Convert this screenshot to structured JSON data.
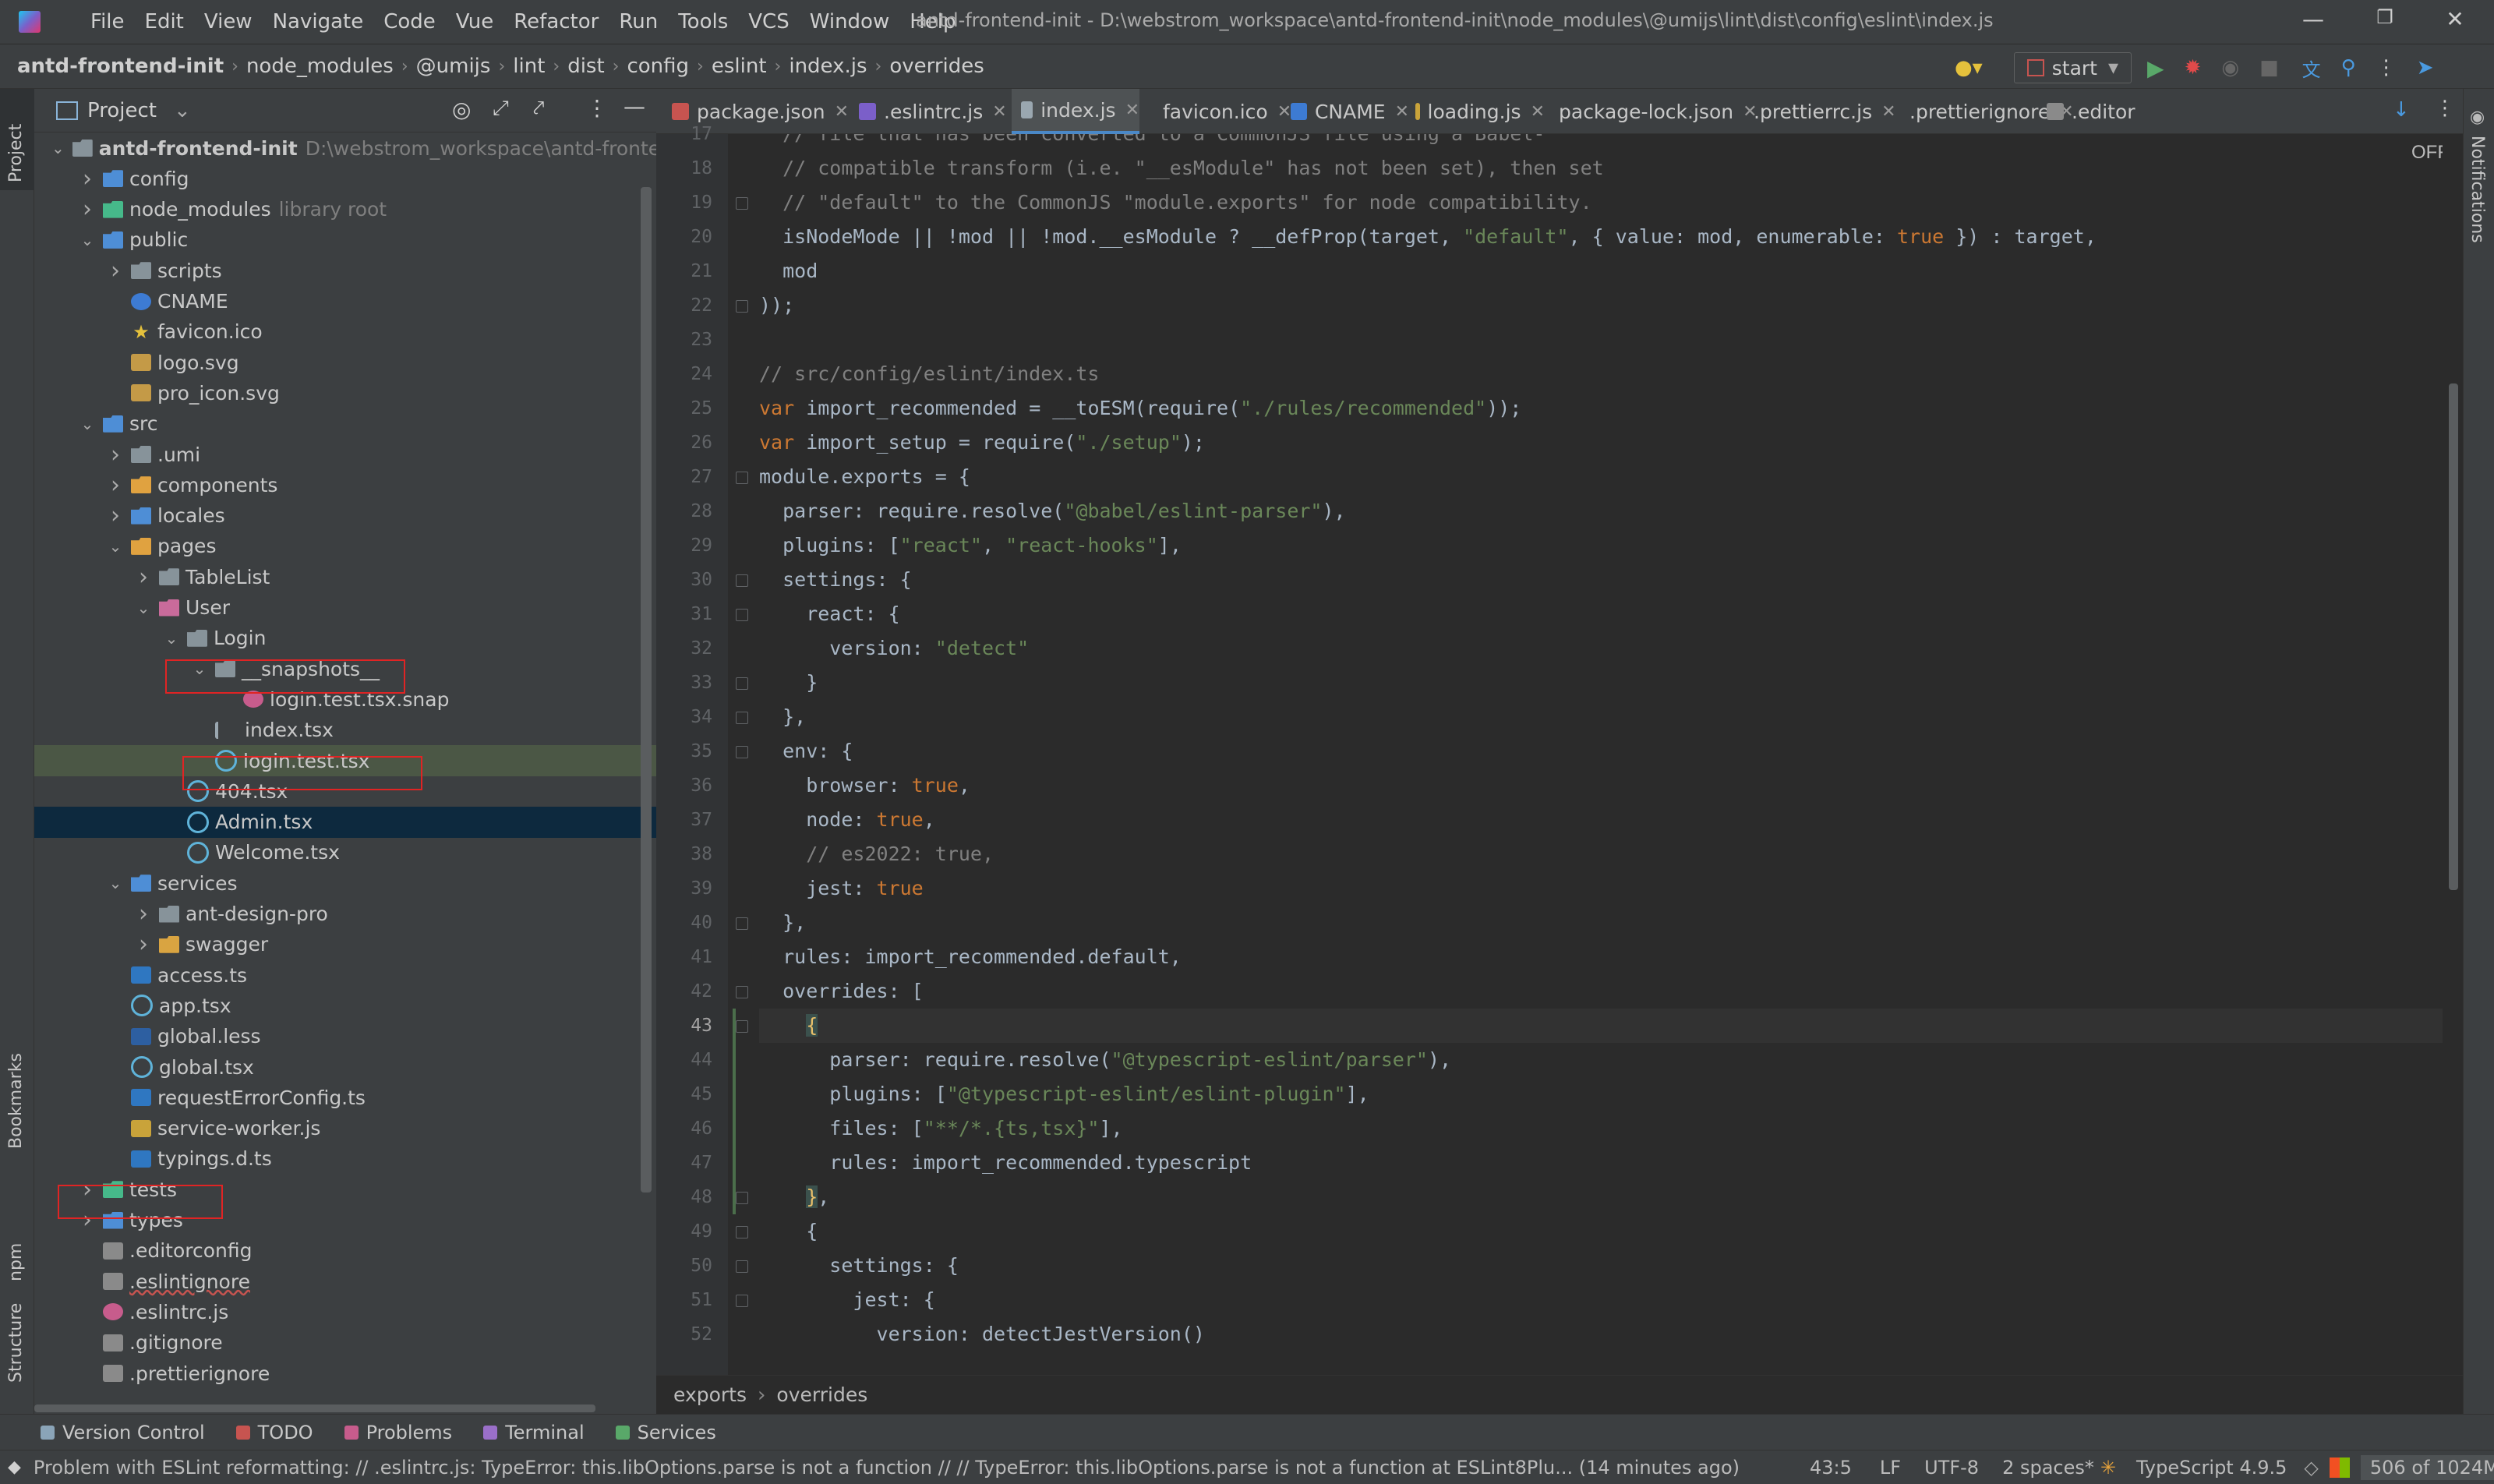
{
  "menubar": {
    "items": [
      "File",
      "Edit",
      "View",
      "Navigate",
      "Code",
      "Vue",
      "Refactor",
      "Run",
      "Tools",
      "VCS",
      "Window",
      "Help"
    ],
    "title": "antd-frontend-init - D:\\webstrom_workspace\\antd-frontend-init\\node_modules\\@umijs\\lint\\dist\\config\\eslint\\index.js"
  },
  "navbar": {
    "crumbs": [
      "antd-frontend-init",
      "node_modules",
      "@umijs",
      "lint",
      "dist",
      "config",
      "eslint",
      "index.js",
      "overrides"
    ],
    "run_config": "start"
  },
  "toolwindow_labels": {
    "project": "Project",
    "bookmarks": "Bookmarks",
    "npm": "npm",
    "structure": "Structure",
    "notifications": "Notifications"
  },
  "project_panel": {
    "title": "Project",
    "tree": [
      {
        "label": "antd-frontend-init",
        "extra": "D:\\webstrom_workspace\\antd-frontend-init",
        "depth": 0,
        "chev": "v",
        "icon": "folder"
      },
      {
        "label": "config",
        "depth": 1,
        "chev": ">",
        "icon": "folder blue"
      },
      {
        "label": "node_modules",
        "extra": "library root",
        "depth": 1,
        "chev": ">",
        "icon": "folder green"
      },
      {
        "label": "public",
        "depth": 1,
        "chev": "v",
        "icon": "folder blue"
      },
      {
        "label": "scripts",
        "depth": 2,
        "chev": ">",
        "icon": "folder"
      },
      {
        "label": "CNAME",
        "depth": 2,
        "chev": "",
        "icon": "file-globe"
      },
      {
        "label": "favicon.ico",
        "depth": 2,
        "chev": "",
        "icon": "file-star"
      },
      {
        "label": "logo.svg",
        "depth": 2,
        "chev": "",
        "icon": "file-svg"
      },
      {
        "label": "pro_icon.svg",
        "depth": 2,
        "chev": "",
        "icon": "file-svg"
      },
      {
        "label": "src",
        "depth": 1,
        "chev": "v",
        "icon": "folder blue"
      },
      {
        "label": ".umi",
        "depth": 2,
        "chev": ">",
        "icon": "folder"
      },
      {
        "label": "components",
        "depth": 2,
        "chev": ">",
        "icon": "folder orange"
      },
      {
        "label": "locales",
        "depth": 2,
        "chev": ">",
        "icon": "folder blue"
      },
      {
        "label": "pages",
        "depth": 2,
        "chev": "v",
        "icon": "folder orange"
      },
      {
        "label": "TableList",
        "depth": 3,
        "chev": ">",
        "icon": "folder"
      },
      {
        "label": "User",
        "depth": 3,
        "chev": "v",
        "icon": "folder pink"
      },
      {
        "label": "Login",
        "depth": 4,
        "chev": "v",
        "icon": "folder"
      },
      {
        "label": "__snapshots__",
        "depth": 5,
        "chev": "v",
        "icon": "folder"
      },
      {
        "label": "login.test.tsx.snap",
        "depth": 6,
        "chev": "",
        "icon": "file-pink"
      },
      {
        "label": "index.tsx",
        "depth": 5,
        "chev": "",
        "icon": "file-lines"
      },
      {
        "label": "login.test.tsx",
        "depth": 5,
        "chev": "",
        "icon": "file-react",
        "state": "highlight"
      },
      {
        "label": "404.tsx",
        "depth": 4,
        "chev": "",
        "icon": "file-react"
      },
      {
        "label": "Admin.tsx",
        "depth": 4,
        "chev": "",
        "icon": "file-react",
        "state": "selected"
      },
      {
        "label": "Welcome.tsx",
        "depth": 4,
        "chev": "",
        "icon": "file-react"
      },
      {
        "label": "services",
        "depth": 2,
        "chev": "v",
        "icon": "folder blue"
      },
      {
        "label": "ant-design-pro",
        "depth": 3,
        "chev": ">",
        "icon": "folder"
      },
      {
        "label": "swagger",
        "depth": 3,
        "chev": ">",
        "icon": "folder yellow"
      },
      {
        "label": "access.ts",
        "depth": 2,
        "chev": "",
        "icon": "file-ts"
      },
      {
        "label": "app.tsx",
        "depth": 2,
        "chev": "",
        "icon": "file-react"
      },
      {
        "label": "global.less",
        "depth": 2,
        "chev": "",
        "icon": "file-less"
      },
      {
        "label": "global.tsx",
        "depth": 2,
        "chev": "",
        "icon": "file-react"
      },
      {
        "label": "requestErrorConfig.ts",
        "depth": 2,
        "chev": "",
        "icon": "file-ts"
      },
      {
        "label": "service-worker.js",
        "depth": 2,
        "chev": "",
        "icon": "file-js"
      },
      {
        "label": "typings.d.ts",
        "depth": 2,
        "chev": "",
        "icon": "file-ts"
      },
      {
        "label": "tests",
        "depth": 1,
        "chev": ">",
        "icon": "folder green"
      },
      {
        "label": "types",
        "depth": 1,
        "chev": ">",
        "icon": "folder blue"
      },
      {
        "label": ".editorconfig",
        "depth": 1,
        "chev": "",
        "icon": "file-generic"
      },
      {
        "label": ".eslintignore",
        "depth": 1,
        "chev": "",
        "icon": "file-generic"
      },
      {
        "label": ".eslintrc.js",
        "depth": 1,
        "chev": "",
        "icon": "file-pink"
      },
      {
        "label": ".gitignore",
        "depth": 1,
        "chev": "",
        "icon": "file-generic"
      },
      {
        "label": ".prettierignore",
        "depth": 1,
        "chev": "",
        "icon": "file-generic"
      }
    ]
  },
  "tabs": [
    {
      "label": "package.json",
      "icon": "#c75450"
    },
    {
      "label": ".eslintrc.js",
      "icon": "#7b5fc9"
    },
    {
      "label": "index.js",
      "icon": "#9aa7b0",
      "active": true
    },
    {
      "label": "favicon.ico",
      "icon": "#e5c13c"
    },
    {
      "label": "CNAME",
      "icon": "#3d7bd3"
    },
    {
      "label": "loading.js",
      "icon": "#c9a33a"
    },
    {
      "label": "package-lock.json",
      "icon": "#e02424"
    },
    {
      "label": ".prettierrc.js",
      "icon": "#c75c8c"
    },
    {
      "label": ".prettierignore",
      "icon": "#6f7b83"
    },
    {
      "label": ".editor",
      "icon": "#8a8a8a"
    }
  ],
  "editor": {
    "inspection_toggle": "OFF",
    "current_line": 43,
    "lines": [
      {
        "n": 17,
        "tokens": [
          [
            "c-comment",
            "  // file that has been converted to a CommonJS file using a Babel-"
          ]
        ]
      },
      {
        "n": 18,
        "tokens": [
          [
            "c-comment",
            "  // compatible transform (i.e. \"__esModule\" has not been set), then set"
          ]
        ]
      },
      {
        "n": 19,
        "tokens": [
          [
            "c-comment",
            "  // \"default\" to the CommonJS \"module.exports\" for node compatibility."
          ]
        ]
      },
      {
        "n": 20,
        "tokens": [
          [
            "c-plain",
            "  isNodeMode || !mod || !mod.__esModule ? __defProp(target, "
          ],
          [
            "c-str",
            "\"default\""
          ],
          [
            "c-plain",
            ", { value: mod, enumerable: "
          ],
          [
            "c-kw",
            "true"
          ],
          [
            "c-plain",
            " }) : target,"
          ]
        ]
      },
      {
        "n": 21,
        "tokens": [
          [
            "c-plain",
            "  mod"
          ]
        ]
      },
      {
        "n": 22,
        "tokens": [
          [
            "c-plain",
            "));"
          ]
        ]
      },
      {
        "n": 23,
        "tokens": [
          [
            "c-plain",
            ""
          ]
        ]
      },
      {
        "n": 24,
        "tokens": [
          [
            "c-comment",
            "// src/config/eslint/index.ts"
          ]
        ]
      },
      {
        "n": 25,
        "tokens": [
          [
            "c-kw",
            "var "
          ],
          [
            "c-plain",
            "import_recommended = __toESM(require("
          ],
          [
            "c-str",
            "\"./rules/recommended\""
          ],
          [
            "c-plain",
            "));"
          ]
        ]
      },
      {
        "n": 26,
        "tokens": [
          [
            "c-kw",
            "var "
          ],
          [
            "c-plain",
            "import_setup = require("
          ],
          [
            "c-str",
            "\"./setup\""
          ],
          [
            "c-plain",
            ");"
          ]
        ]
      },
      {
        "n": 27,
        "tokens": [
          [
            "c-plain",
            "module.exports = {"
          ]
        ]
      },
      {
        "n": 28,
        "tokens": [
          [
            "c-plain",
            "  parser: require.resolve("
          ],
          [
            "c-str",
            "\"@babel/eslint-parser\""
          ],
          [
            "c-plain",
            "),"
          ]
        ]
      },
      {
        "n": 29,
        "tokens": [
          [
            "c-plain",
            "  plugins: ["
          ],
          [
            "c-str",
            "\"react\""
          ],
          [
            "c-plain",
            ", "
          ],
          [
            "c-str",
            "\"react-hooks\""
          ],
          [
            "c-plain",
            "],"
          ]
        ]
      },
      {
        "n": 30,
        "tokens": [
          [
            "c-plain",
            "  settings: {"
          ]
        ]
      },
      {
        "n": 31,
        "tokens": [
          [
            "c-plain",
            "    react: {"
          ]
        ]
      },
      {
        "n": 32,
        "tokens": [
          [
            "c-plain",
            "      version: "
          ],
          [
            "c-str",
            "\"detect\""
          ]
        ]
      },
      {
        "n": 33,
        "tokens": [
          [
            "c-plain",
            "    }"
          ]
        ]
      },
      {
        "n": 34,
        "tokens": [
          [
            "c-plain",
            "  },"
          ]
        ]
      },
      {
        "n": 35,
        "tokens": [
          [
            "c-plain",
            "  env: {"
          ]
        ]
      },
      {
        "n": 36,
        "tokens": [
          [
            "c-plain",
            "    browser: "
          ],
          [
            "c-kw",
            "true"
          ],
          [
            "c-plain",
            ","
          ]
        ]
      },
      {
        "n": 37,
        "tokens": [
          [
            "c-plain",
            "    node: "
          ],
          [
            "c-kw",
            "true"
          ],
          [
            "c-plain",
            ","
          ]
        ]
      },
      {
        "n": 38,
        "tokens": [
          [
            "c-comment",
            "    // es2022: true,"
          ]
        ]
      },
      {
        "n": 39,
        "tokens": [
          [
            "c-plain",
            "    jest: "
          ],
          [
            "c-kw",
            "true"
          ]
        ]
      },
      {
        "n": 40,
        "tokens": [
          [
            "c-plain",
            "  },"
          ]
        ]
      },
      {
        "n": 41,
        "tokens": [
          [
            "c-plain",
            "  rules: import_recommended.default,"
          ]
        ]
      },
      {
        "n": 42,
        "tokens": [
          [
            "c-plain",
            "  overrides: ["
          ]
        ]
      },
      {
        "n": 43,
        "tokens": [
          [
            "c-plain",
            "    "
          ],
          [
            "c-brace",
            "{"
          ]
        ]
      },
      {
        "n": 44,
        "tokens": [
          [
            "c-plain",
            "      parser: require.resolve("
          ],
          [
            "c-str",
            "\"@typescript-eslint/parser\""
          ],
          [
            "c-plain",
            "),"
          ]
        ]
      },
      {
        "n": 45,
        "tokens": [
          [
            "c-plain",
            "      plugins: ["
          ],
          [
            "c-str",
            "\"@typescript-eslint/eslint-plugin\""
          ],
          [
            "c-plain",
            "],"
          ]
        ]
      },
      {
        "n": 46,
        "tokens": [
          [
            "c-plain",
            "      files: ["
          ],
          [
            "c-str",
            "\"**/*.{ts,tsx}\""
          ],
          [
            "c-plain",
            "],"
          ]
        ]
      },
      {
        "n": 47,
        "tokens": [
          [
            "c-plain",
            "      rules: import_recommended.typescript"
          ]
        ]
      },
      {
        "n": 48,
        "tokens": [
          [
            "c-plain",
            "    "
          ],
          [
            "c-brace",
            "}"
          ],
          [
            "c-plain",
            ","
          ]
        ]
      },
      {
        "n": 49,
        "tokens": [
          [
            "c-plain",
            "    {"
          ]
        ]
      },
      {
        "n": 50,
        "tokens": [
          [
            "c-plain",
            "      settings: {"
          ]
        ]
      },
      {
        "n": 51,
        "tokens": [
          [
            "c-plain",
            "        jest: {"
          ]
        ]
      },
      {
        "n": 52,
        "tokens": [
          [
            "c-plain",
            "          version: detectJestVersion()"
          ]
        ]
      }
    ]
  },
  "editor_breadcrumb": [
    "exports",
    "overrides"
  ],
  "bottom_tabs": [
    {
      "label": "Version Control",
      "color": "#8aa4b8"
    },
    {
      "label": "TODO",
      "color": "#c75450"
    },
    {
      "label": "Problems",
      "color": "#c75c8c"
    },
    {
      "label": "Terminal",
      "color": "#9a6fc9"
    },
    {
      "label": "Services",
      "color": "#59a869"
    }
  ],
  "statusbar": {
    "message": "Problem with ESLint reformatting: // .eslintrc.js: TypeError: this.libOptions.parse is not a function // // TypeError: this.libOptions.parse is not a function    at ESLint8Plu... (14 minutes ago)",
    "position": "43:5",
    "line_sep": "LF",
    "encoding": "UTF-8",
    "indent": "2 spaces*",
    "language": "TypeScript 4.9.5",
    "memory": "506 of 1024M"
  }
}
